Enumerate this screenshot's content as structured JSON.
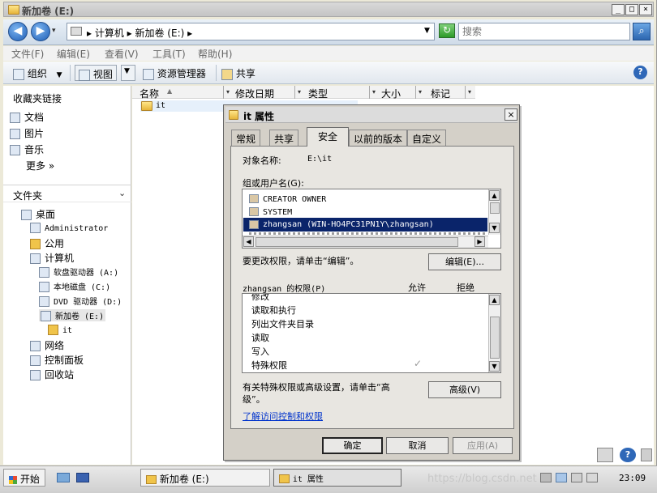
{
  "window": {
    "title": "新加卷 (E:)",
    "buttons": {
      "minimize": "_",
      "maximize": "□",
      "close": "×"
    }
  },
  "nav": {
    "back": "◀",
    "forward": "▶",
    "address": "▸ 计算机 ▸ 新加卷 (E:) ▸",
    "search_placeholder": "搜索"
  },
  "menu": [
    "文件(F)",
    "编辑(E)",
    "查看(V)",
    "工具(T)",
    "帮助(H)"
  ],
  "toolbar": {
    "organize": "组织",
    "view": "视图",
    "explorer": "资源管理器",
    "share": "共享"
  },
  "sidebar": {
    "favorites_title": "收藏夹链接",
    "favorites": [
      "文档",
      "图片",
      "音乐"
    ],
    "more": "更多  »",
    "folders_title": "文件夹",
    "tree": [
      {
        "label": "桌面",
        "indent": 0
      },
      {
        "label": "Administrator",
        "indent": 1
      },
      {
        "label": "公用",
        "indent": 1
      },
      {
        "label": "计算机",
        "indent": 1
      },
      {
        "label": "软盘驱动器 (A:)",
        "indent": 2
      },
      {
        "label": "本地磁盘 (C:)",
        "indent": 2
      },
      {
        "label": "DVD 驱动器 (D:)",
        "indent": 2
      },
      {
        "label": "新加卷 (E:)",
        "indent": 2
      },
      {
        "label": "it",
        "indent": 3
      },
      {
        "label": "网络",
        "indent": 1
      },
      {
        "label": "控制面板",
        "indent": 1
      },
      {
        "label": "回收站",
        "indent": 1
      }
    ]
  },
  "filelist": {
    "columns": [
      "名称",
      "修改日期",
      "类型",
      "大小",
      "标记"
    ],
    "rows": [
      {
        "name": "it"
      }
    ]
  },
  "dialog": {
    "title": "it 属性",
    "close": "×",
    "tabs": [
      "常规",
      "共享",
      "安全",
      "以前的版本",
      "自定义"
    ],
    "active_tab": "安全",
    "object_label": "对象名称:",
    "object_value": "E:\\it",
    "groups_label": "组或用户名(G):",
    "groups": [
      "CREATOR OWNER",
      "SYSTEM",
      "zhangsan (WIN-HO4PC31PN1Y\\zhangsan)"
    ],
    "edit_hint": "要更改权限，请单击“编辑”。",
    "edit_button": "编辑(E)...",
    "perm_label": "zhangsan 的权限(P)",
    "allow": "允许",
    "deny": "拒绝",
    "permissions": [
      "修改",
      "读取和执行",
      "列出文件夹目录",
      "读取",
      "写入",
      "特殊权限"
    ],
    "special_check": "✓",
    "advanced_hint_1": "有关特殊权限或高级设置，请单击“高",
    "advanced_hint_2": "级”。",
    "advanced_button": "高级(V)",
    "link": "了解访问控制和权限",
    "ok": "确定",
    "cancel": "取消",
    "apply": "应用(A)"
  },
  "taskbar": {
    "start": "开始",
    "tasks": [
      "新加卷 (E:)",
      "it 属性"
    ],
    "clock": "23:09",
    "watermark": "https://blog.csdn.net"
  }
}
